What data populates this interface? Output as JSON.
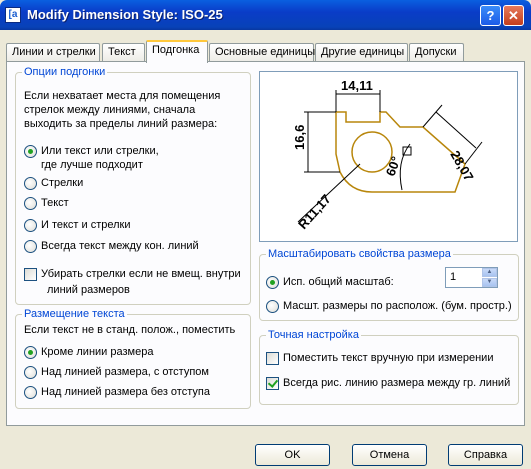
{
  "window": {
    "title": "Modify Dimension Style: ISO-25",
    "icon_label": "[a",
    "help_label": "?",
    "close_label": "✕"
  },
  "tabs": [
    "Линии и стрелки",
    "Текст",
    "Подгонка",
    "Основные единицы",
    "Другие единицы",
    "Допуски"
  ],
  "fit_options": {
    "title": "Опции подгонки",
    "description": [
      "Если нехватает места для помещения",
      "стрелок между линиями, сначала",
      "выходить за пределы линий размера:"
    ],
    "radios": [
      {
        "label": "Или текст или стрелки,",
        "label2": "где лучше подходит",
        "selected": true
      },
      {
        "label": "Стрелки",
        "selected": false
      },
      {
        "label": "Текст",
        "selected": false
      },
      {
        "label": "И текст и стрелки",
        "selected": false
      },
      {
        "label": "Всегда текст между кон. линий",
        "selected": false
      }
    ],
    "checkbox": {
      "label": "Убирать стрелки если не вмещ. внутри",
      "label2": "линий размеров",
      "checked": false
    }
  },
  "text_placement": {
    "title": "Размещение текста",
    "description": "Если текст не в станд. полож., поместить",
    "radios": [
      {
        "label": "Кроме линии размера",
        "selected": true
      },
      {
        "label": "Над линией размера, с отступом",
        "selected": false
      },
      {
        "label": "Над линией размера без отступа",
        "selected": false
      }
    ]
  },
  "preview": {
    "dim_top": "14,11",
    "dim_left": "16,6",
    "dim_right": "28,07",
    "angle": "60°",
    "radius": "R11,17",
    "colors": {
      "body": "#b8860b",
      "dims": "#000000"
    }
  },
  "scale": {
    "title": "Масштабировать свойства размера",
    "overall_label": "Исп. общий масштаб:",
    "overall_value": "1",
    "overall_selected": true,
    "layout_label": "Масшт. размеры по располож. (бум. простр.)",
    "layout_selected": false
  },
  "fine_tuning": {
    "title": "Точная настройка",
    "manual_label": "Поместить текст вручную при измерении",
    "manual_checked": false,
    "always_label": "Всегда рис. линию размера между гр. линий",
    "always_checked": true
  },
  "buttons": {
    "ok": "OK",
    "cancel": "Отмена",
    "help": "Справка"
  }
}
